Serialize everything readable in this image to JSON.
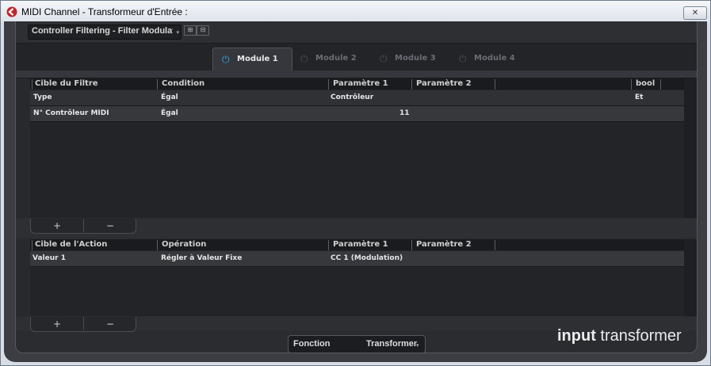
{
  "window": {
    "title": "MIDI Channel - Transformeur d'Entrée :",
    "close_label": "✕"
  },
  "preset": {
    "value": "Controller Filtering - Filter Modulation",
    "add_icon": "store-preset-icon",
    "remove_icon": "remove-preset-icon"
  },
  "tabs": [
    {
      "label": "Module 1",
      "active": true
    },
    {
      "label": "Module 2",
      "active": false
    },
    {
      "label": "Module 3",
      "active": false
    },
    {
      "label": "Module 4",
      "active": false
    }
  ],
  "filter_table": {
    "headers": [
      "Cible du Filtre",
      "Condition",
      "Paramètre 1",
      "Paramètre 2",
      "",
      "bool",
      ""
    ],
    "rows": [
      {
        "target": "Type",
        "condition": "Égal",
        "param1": "Contrôleur",
        "param2": "",
        "bool": "Et"
      },
      {
        "target": "N° Contrôleur MIDI",
        "condition": "Égal",
        "param1": "11",
        "param2": "",
        "bool": ""
      }
    ],
    "add_label": "+",
    "remove_label": "−"
  },
  "action_table": {
    "headers": [
      "Cible de l'Action",
      "Opération",
      "Paramètre 1",
      "Paramètre 2",
      ""
    ],
    "rows": [
      {
        "target": "Valeur 1",
        "operation": "Régler à Valeur Fixe",
        "param1": "CC 1  (Modulation)",
        "param2": ""
      }
    ],
    "add_label": "+",
    "remove_label": "−"
  },
  "function": {
    "label": "Fonction",
    "value": "Transformer"
  },
  "branding": {
    "bold": "input",
    "light": " transformer"
  },
  "colors": {
    "tab_active_icon": "#2aa9e0",
    "tab_inactive_icon": "#4a4d53",
    "tab_active_text": "#e8e8e8",
    "tab_inactive_text": "#6a6d73"
  }
}
